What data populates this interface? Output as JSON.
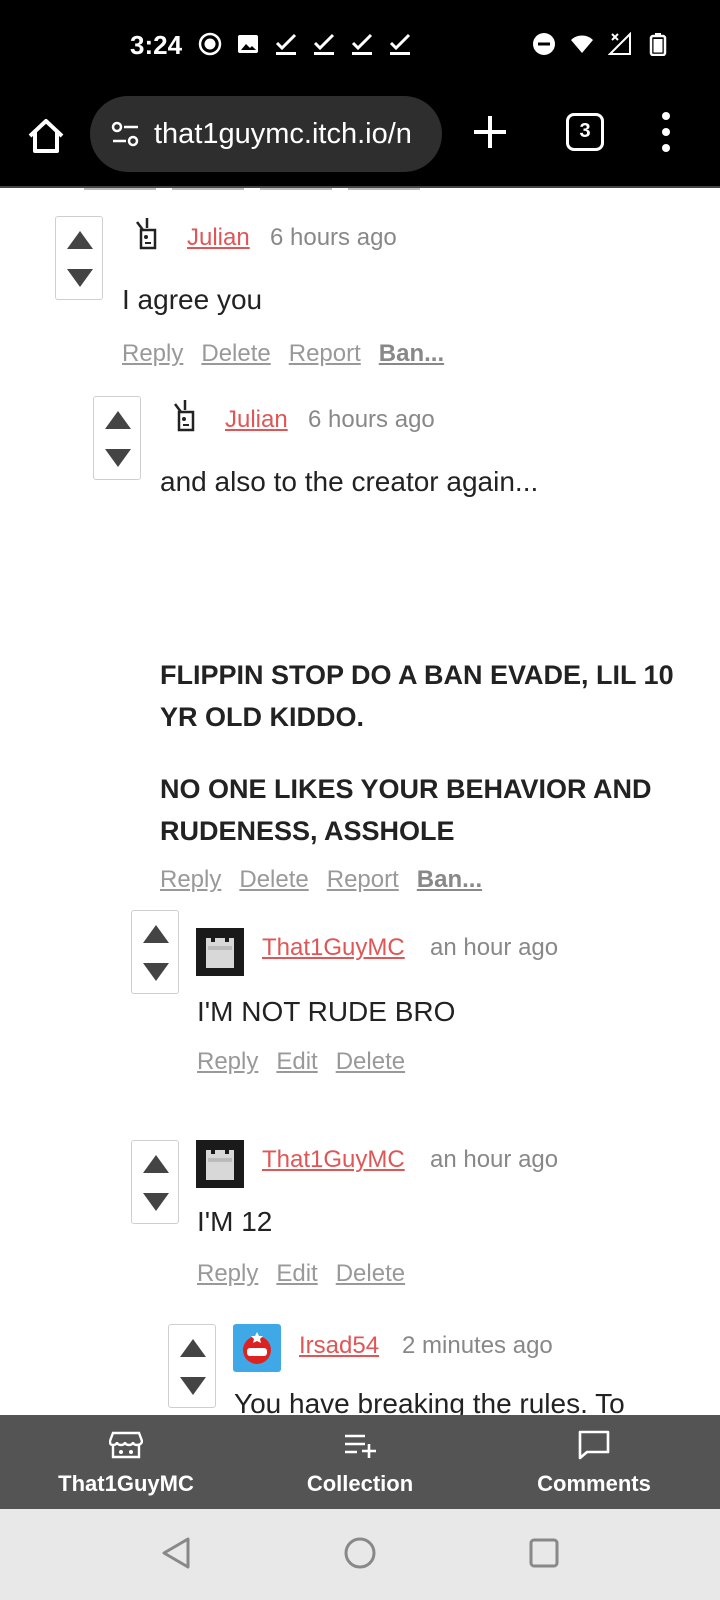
{
  "status_bar": {
    "time": "3:24",
    "left_icons": [
      "record-icon",
      "image-icon",
      "check-icon",
      "check-icon",
      "check-icon",
      "check-icon"
    ],
    "right_icons": [
      "dnd-icon",
      "wifi-icon",
      "signal-icon",
      "battery-icon"
    ]
  },
  "browser": {
    "url": "that1guymc.itch.io/n",
    "tab_count": "3"
  },
  "comments": [
    {
      "author": "Julian",
      "time": "6 hours ago",
      "body": "I agree you",
      "actions": [
        "Reply",
        "Delete",
        "Report",
        "Ban..."
      ]
    },
    {
      "author": "Julian",
      "time": "6 hours ago",
      "body_lines": [
        "and also to the creator again...",
        "FLIPPIN STOP DO A BAN EVADE, LIL 10 YR OLD KIDDO.",
        "NO ONE LIKES YOUR BEHAVIOR AND RUDENESS, ASSHOLE"
      ],
      "actions": [
        "Reply",
        "Delete",
        "Report",
        "Ban..."
      ]
    },
    {
      "author": "That1GuyMC",
      "time": "an hour ago",
      "body": "I'M NOT RUDE BRO",
      "actions": [
        "Reply",
        "Edit",
        "Delete"
      ]
    },
    {
      "author": "That1GuyMC",
      "time": "an hour ago",
      "body": "I'M 12",
      "actions": [
        "Reply",
        "Edit",
        "Delete"
      ]
    },
    {
      "author": "Irsad54",
      "time": "2 minutes ago",
      "body": "You have breaking the rules. To"
    }
  ],
  "bottom_bar": {
    "items": [
      {
        "label": "That1GuyMC",
        "icon": "itch-store-icon"
      },
      {
        "label": "Collection",
        "icon": "add-to-list-icon"
      },
      {
        "label": "Comments",
        "icon": "comment-icon"
      }
    ]
  },
  "colors": {
    "author": "#e05656",
    "muted": "#999999",
    "bottom_bar": "#545454"
  }
}
